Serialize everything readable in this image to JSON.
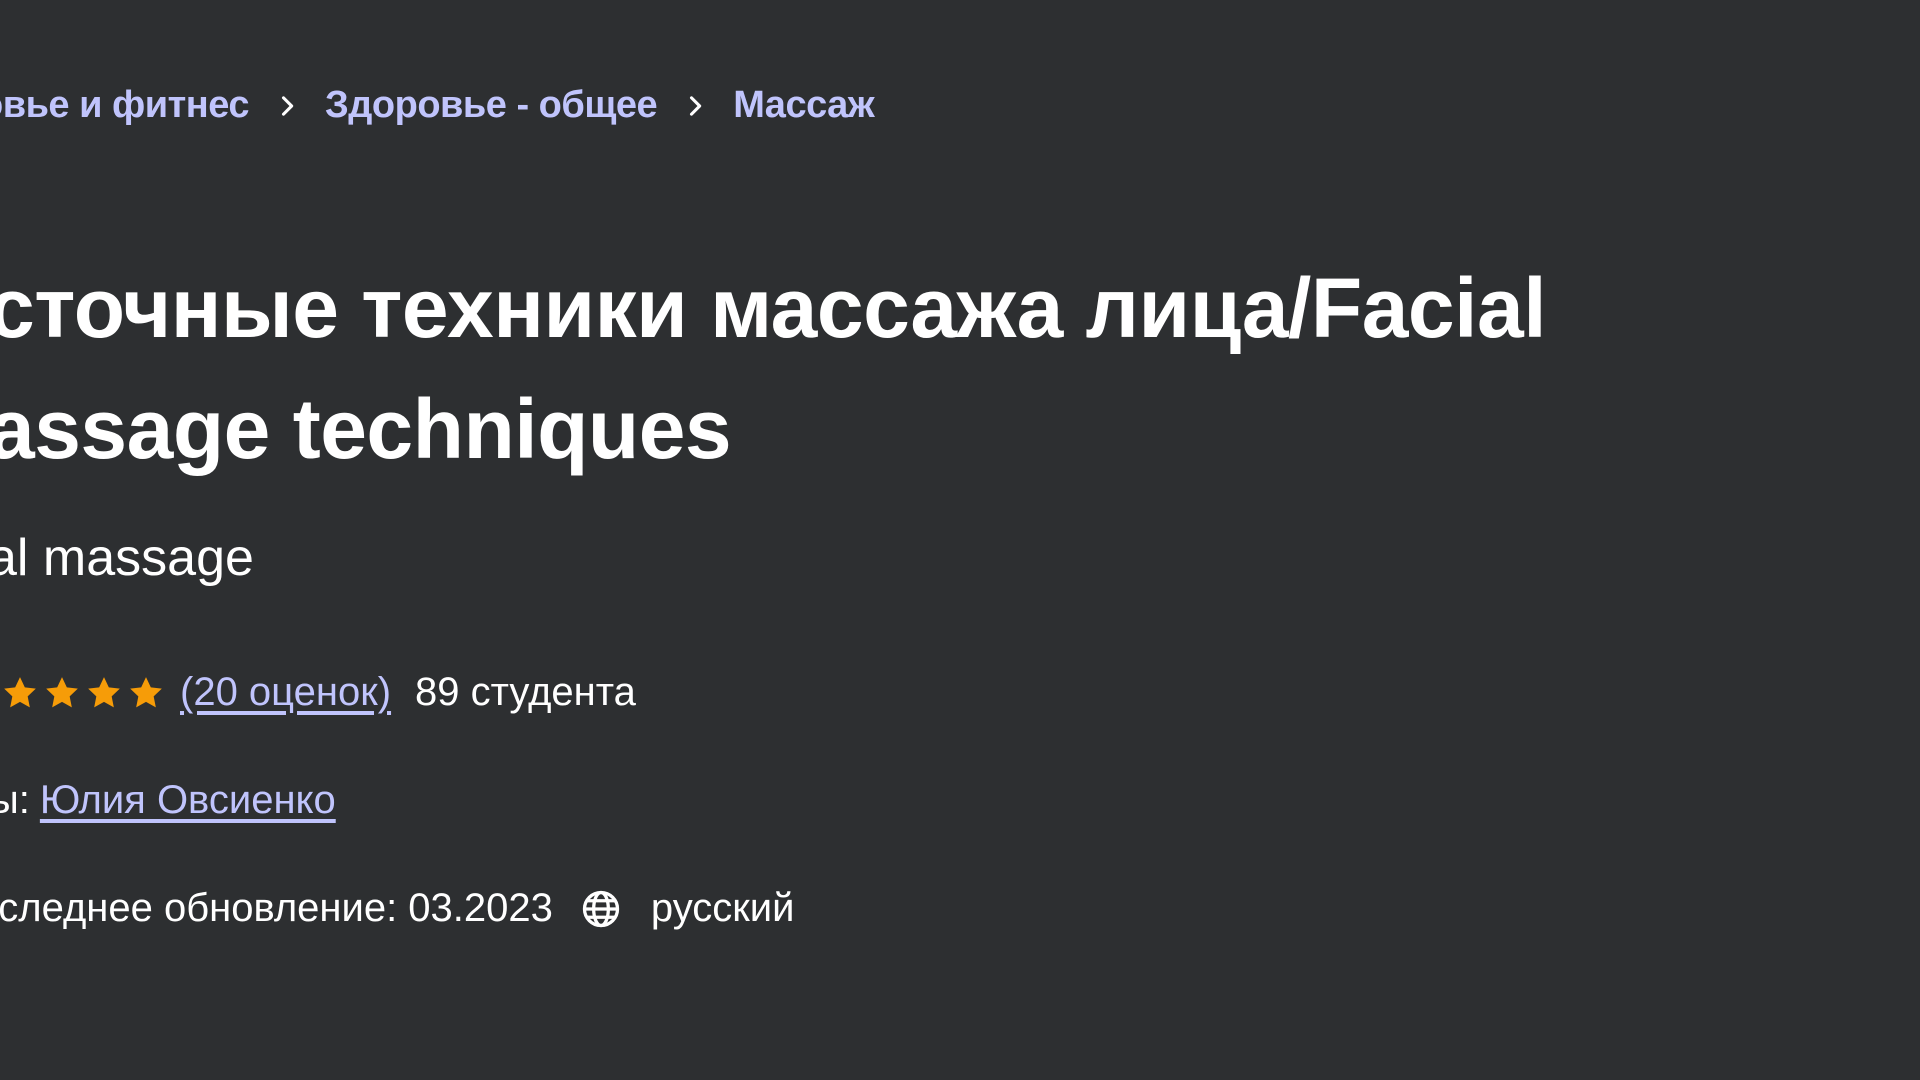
{
  "breadcrumb": {
    "items": [
      {
        "label": "овье и фитнес"
      },
      {
        "label": "Здоровье - общее"
      },
      {
        "label": "Массаж"
      }
    ],
    "separator_icon": "chevron-right-icon"
  },
  "course": {
    "title": "сточные техники массажа лица/Facial assage techniques",
    "subtitle": "al massage",
    "rating": {
      "stars_shown": 4,
      "count_label": "(20 оценок)",
      "students_label": "89 студента",
      "star_color": "#f69c08"
    },
    "authors": {
      "label": "ы:",
      "name": "Юлия Овсиенко"
    },
    "meta": {
      "updated_label": "оследнее обновление: 03.2023",
      "language_icon": "globe-icon",
      "language": "русский"
    }
  },
  "colors": {
    "background": "#2d2f31",
    "link": "#c0c4fc",
    "text": "#ffffff"
  }
}
